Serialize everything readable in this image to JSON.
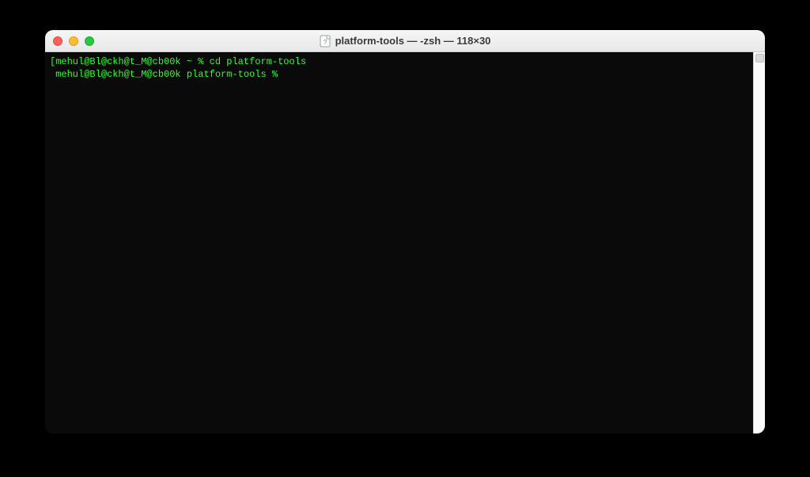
{
  "window": {
    "title": "platform-tools — -zsh — 118×30"
  },
  "colors": {
    "prompt_green": "#2fff2f",
    "background": "#0a0a0a"
  },
  "terminal": {
    "lines": [
      {
        "prefix_open": "[",
        "userhost": "mehul@Bl@ckh@t_M@cb00k",
        "cwd": "~",
        "sep": " % ",
        "command": "cd platform-tools"
      },
      {
        "prefix_open": " ",
        "userhost": "mehul@Bl@ckh@t_M@cb00k",
        "cwd": "platform-tools",
        "sep": " % ",
        "command": ""
      }
    ]
  }
}
